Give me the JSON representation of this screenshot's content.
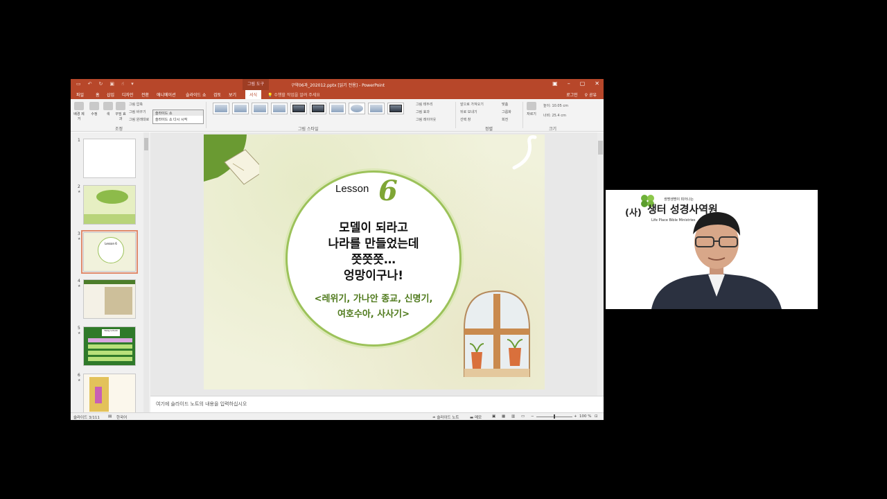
{
  "window": {
    "context_label": "그림 도구",
    "doc_title": "구약06과_202012.pptx [읽기 전용] - PowerPoint",
    "qat_icons": [
      "save-icon",
      "undo-icon",
      "redo-icon",
      "present-icon",
      "touch-icon"
    ]
  },
  "tabs": [
    {
      "label": "파일",
      "active": false
    },
    {
      "label": "홈",
      "active": false
    },
    {
      "label": "삽입",
      "active": false
    },
    {
      "label": "디자인",
      "active": false
    },
    {
      "label": "전환",
      "active": false
    },
    {
      "label": "애니메이션",
      "active": false
    },
    {
      "label": "슬라이드 쇼",
      "active": false
    },
    {
      "label": "검토",
      "active": false
    },
    {
      "label": "보기",
      "active": false
    },
    {
      "label": "서식",
      "active": true
    }
  ],
  "tell_me": "수행할 작업을 알려 주세요",
  "signin": "로그인",
  "share": "공유",
  "ribbon": {
    "adjust_buttons": [
      "배경 제거",
      "수정",
      "색",
      "꾸밈 효과"
    ],
    "adjust_small": [
      "그림 압축",
      "그림 바꾸기",
      "그림 원래대로"
    ],
    "adjust_group": "조정",
    "styles_group": "그림 스타일",
    "styles_small": [
      "그림 테두리",
      "그림 효과",
      "그림 레이아웃"
    ],
    "arrange_small": [
      "앞으로 가져오기",
      "뒤로 보내기",
      "선택 창",
      "맞춤",
      "그룹화",
      "회전"
    ],
    "arrange_group": "정렬",
    "size_group": "크기",
    "crop_label": "자르기",
    "height_label": "높이:",
    "height_value": "10.05 cm",
    "width_label": "너비:",
    "width_value": "25.4 cm"
  },
  "tooltip": {
    "header": "슬라이드 쇼",
    "body": "슬라이드 쇼 다시 시작"
  },
  "thumbnails": [
    {
      "num": "1",
      "star": ""
    },
    {
      "num": "2",
      "star": "★"
    },
    {
      "num": "3",
      "star": "★",
      "selected": true,
      "lesson": "Lesson 6"
    },
    {
      "num": "4",
      "star": "★"
    },
    {
      "num": "5",
      "star": "★",
      "title": "Today's Point"
    },
    {
      "num": "6",
      "star": "★"
    }
  ],
  "slide": {
    "lesson_word": "Lesson",
    "lesson_number": "6",
    "headline": [
      "모델이 되라고",
      "나라를 만들었는데",
      "쯧쯧쯧…",
      "엉망이구나!"
    ],
    "subline": [
      "<레위기, 가나안 종교, 신명기,",
      "여호수아, 사사기>"
    ]
  },
  "notes_placeholder": "여기에 슬라이드 노트의 내용을 입력하십시오",
  "status": {
    "slide_count": "슬라이드 3/111",
    "language": "한국어",
    "notes_btn": "슬라이드 노트",
    "comments_btn": "메모",
    "zoom": "100 %"
  },
  "webcam": {
    "logo_prefix": "(사)",
    "logo_name": "생터 성경사역원",
    "logo_tagline": "생명생명이 피어나는",
    "logo_english": "Life Place Bible Ministries"
  },
  "colors": {
    "ppt_red": "#b7472a",
    "slide_bg": "#f1f2dc",
    "accent_green": "#7fa635"
  }
}
